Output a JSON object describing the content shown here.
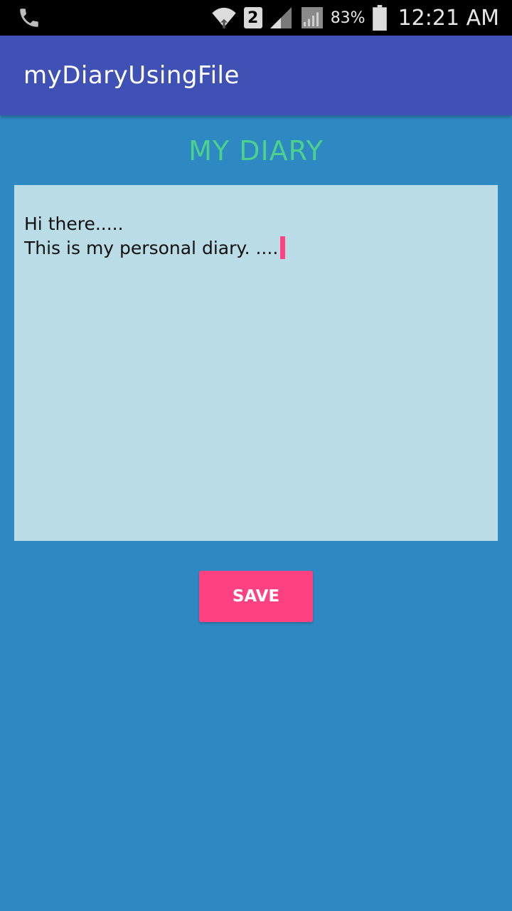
{
  "status_bar": {
    "battery_percent": "83%",
    "sim_slot": "2",
    "time": "12:21 AM",
    "icons": [
      "phone-icon",
      "wifi-icon",
      "signal-icon",
      "signal-icon-2",
      "battery-icon"
    ]
  },
  "app_bar": {
    "title": "myDiaryUsingFile"
  },
  "main": {
    "heading": "MY DIARY",
    "diary_lines": [
      "Hi there.....",
      "This is my personal diary. ...."
    ],
    "save_label": "SAVE"
  },
  "colors": {
    "background": "#2e88c2",
    "app_bar": "#3f51b5",
    "heading": "#4cd08d",
    "diary_box": "#badce6",
    "accent": "#ff4081"
  }
}
